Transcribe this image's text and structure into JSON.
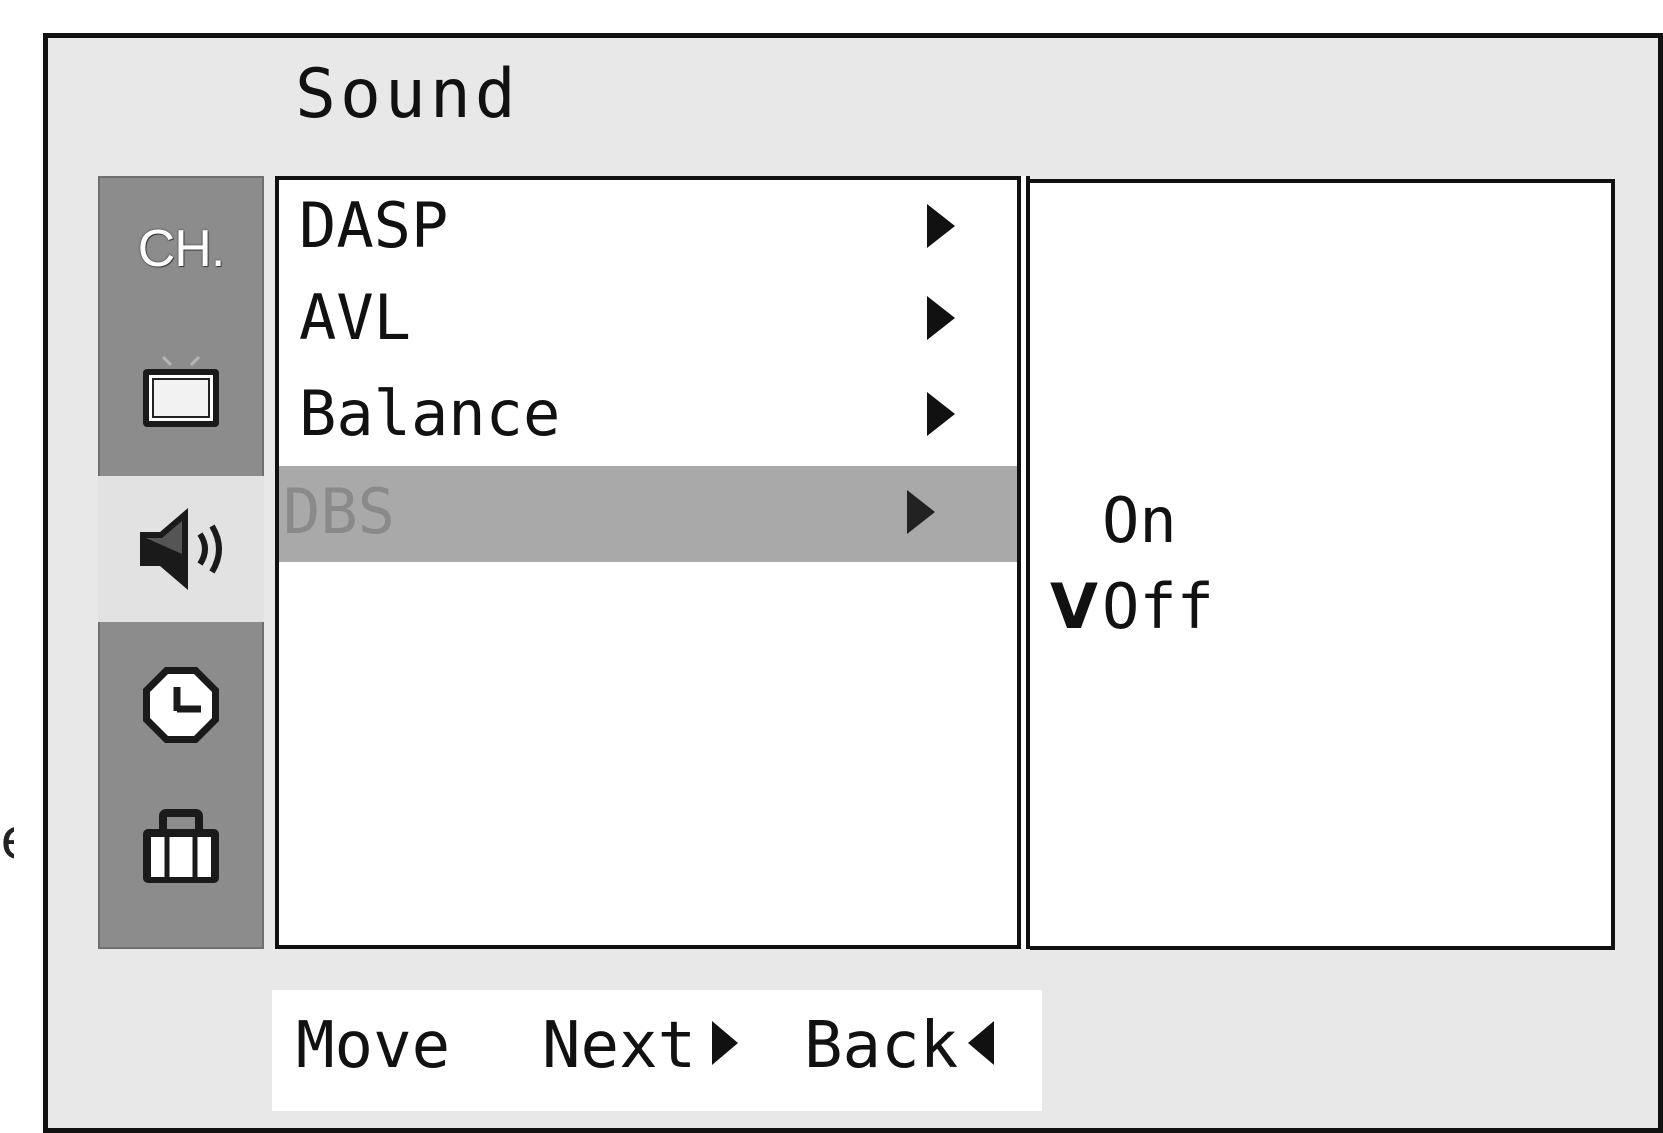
{
  "stray_char": "e",
  "menu": {
    "title": "Sound"
  },
  "sidebar": {
    "items": [
      {
        "label": "CH.",
        "icon": "channel-text-icon",
        "selected": false
      },
      {
        "label": "",
        "icon": "tv-screen-icon",
        "selected": false
      },
      {
        "label": "",
        "icon": "speaker-icon",
        "selected": true
      },
      {
        "label": "",
        "icon": "clock-icon",
        "selected": false
      },
      {
        "label": "",
        "icon": "toolbox-icon",
        "selected": false
      }
    ]
  },
  "list": {
    "items": [
      {
        "label": "DASP",
        "highlighted": false
      },
      {
        "label": "AVL",
        "highlighted": false
      },
      {
        "label": "Balance",
        "highlighted": false
      },
      {
        "label": "DBS",
        "highlighted": true
      }
    ]
  },
  "options": {
    "items": [
      {
        "label": "On",
        "checked": false,
        "mark": ""
      },
      {
        "label": "Off",
        "checked": true,
        "mark": "V"
      }
    ]
  },
  "help": {
    "move_label": "Move",
    "next_label": "Next",
    "back_label": "Back"
  },
  "colors": {
    "sidebar_bg": "#8c8c8c",
    "highlight_row": "#a9a9a9",
    "frame_bg": "#e8e8e8"
  }
}
